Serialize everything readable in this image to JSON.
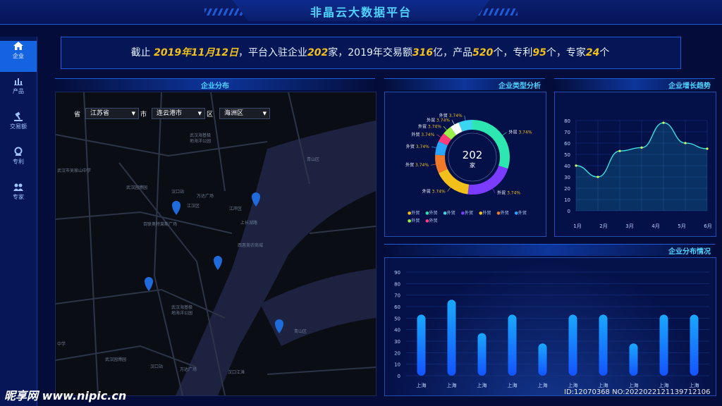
{
  "header": {
    "title": "非晶云大数据平台"
  },
  "sidebar": {
    "items": [
      {
        "label": "企业",
        "icon": "home-icon",
        "active": true
      },
      {
        "label": "产品",
        "icon": "bar-chart-icon",
        "active": false
      },
      {
        "label": "交易额",
        "icon": "hammer-icon",
        "active": false
      },
      {
        "label": "专利",
        "icon": "patent-icon",
        "active": false
      },
      {
        "label": "专家",
        "icon": "users-icon",
        "active": false
      }
    ]
  },
  "banner": {
    "p1": "截止 ",
    "date": "2019年11月12日",
    "p2": "，平台入驻企业",
    "companies": "202",
    "p3": "家，2019年交易额",
    "volume": "316",
    "p4": "亿，产品",
    "products": "520",
    "p5": "个，专利",
    "patents": "95",
    "p6": "个，专家",
    "experts": "24",
    "p7": "个"
  },
  "map_panel": {
    "title": "企业分布",
    "province_label": "省",
    "province_value": "江苏省",
    "city_label": "市",
    "city_value": "连云港市",
    "district_label": "区",
    "district_value": "海洲区",
    "places": [
      "武汉海基极",
      "地海洋公园",
      "武汉市吴家山中学",
      "青山区",
      "武汉园博园",
      "汉口站",
      "万达广场",
      "江汉区",
      "江岸区",
      "百联奥特莱斯广场",
      "上长湖路",
      "西惠美农商城",
      "武汉海基极",
      "地海洋公园",
      "青山区",
      "汉口站",
      "万达广场",
      "汉口江滩",
      "武汉园博园",
      "中学"
    ]
  },
  "donut_panel": {
    "title": "企业类型分析",
    "center_value": "202",
    "center_unit": "家",
    "slice_label": "外贸",
    "slice_pct": "3.74%",
    "legend": [
      "外贸",
      "外贸",
      "外贸",
      "外贸",
      "外贸",
      "外贸",
      "外贸",
      "外贸",
      "外贸"
    ]
  },
  "trend_panel": {
    "title": "企业增长趋势"
  },
  "bar_panel": {
    "title": "企业分布情况"
  },
  "watermark": {
    "site": "昵享网 www.nipic.cn",
    "id": "ID:12070368 NO:20220221211397121​06"
  },
  "colors": {
    "accent": "#4fd3ff",
    "highlight": "#f2c01b",
    "bar": "#1d8cff"
  },
  "chart_data": [
    {
      "type": "pie",
      "title": "企业类型分析",
      "categories": [
        "外贸",
        "外贸",
        "外贸",
        "外贸",
        "外贸",
        "外贸",
        "外贸",
        "外贸",
        "外贸"
      ],
      "values": [
        30,
        22,
        16,
        8,
        6,
        4,
        4,
        4,
        6
      ],
      "colors": [
        "#2de6b0",
        "#7b3cff",
        "#f2c01b",
        "#f07a2a",
        "#2aa6ff",
        "#ff3d7a",
        "#9cf04a",
        "#ffffff",
        "#3ad6f0"
      ]
    },
    {
      "type": "line",
      "title": "企业增长趋势",
      "categories": [
        "1月",
        "2月",
        "3月",
        "4月",
        "5月",
        "6月"
      ],
      "x": [
        1,
        2,
        3,
        4,
        5,
        6
      ],
      "values": [
        40,
        30,
        53,
        56,
        78,
        60,
        55
      ],
      "ylim": [
        0,
        80
      ],
      "yticks": [
        0,
        10,
        20,
        30,
        40,
        50,
        60,
        70,
        80
      ]
    },
    {
      "type": "bar",
      "title": "企业分布情况",
      "categories": [
        "上海",
        "上海",
        "上海",
        "上海",
        "上海",
        "上海",
        "上海",
        "上海",
        "上海",
        "上海"
      ],
      "values": [
        53,
        66,
        37,
        53,
        28,
        53,
        53,
        28,
        53,
        53
      ],
      "ylim": [
        0,
        90
      ],
      "yticks": [
        0,
        10,
        20,
        30,
        40,
        50,
        60,
        70,
        80,
        90
      ]
    }
  ]
}
